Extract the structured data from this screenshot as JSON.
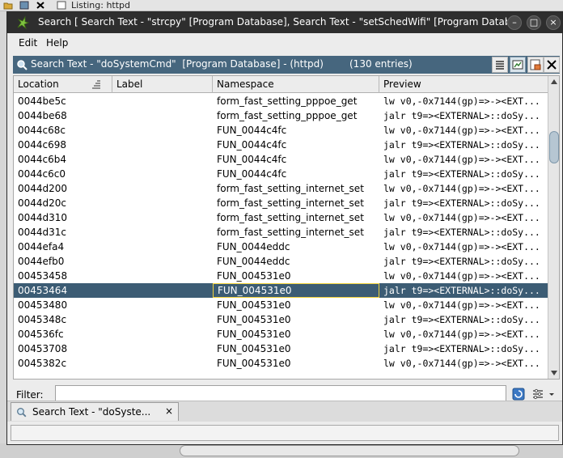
{
  "background": {
    "listing_label": "Listing:  httpd"
  },
  "window": {
    "title": "Search [ Search Text - \"strcpy\"  [Program Database], Search Text - \"setSchedWifi\"  [Program Database],",
    "buttons": {
      "minimize": "–",
      "maximize": "□",
      "close": "×"
    }
  },
  "menu": {
    "edit": "Edit",
    "help": "Help"
  },
  "panel": {
    "title": "Search Text - \"doSystemCmd\"  [Program Database] - (httpd)",
    "count": "(130 entries)"
  },
  "table": {
    "columns": {
      "location": "Location",
      "label": "Label",
      "namespace": "Namespace",
      "preview": "Preview"
    },
    "selected_index": 13,
    "rows": [
      {
        "location": "0044be5c",
        "label": "",
        "namespace": "form_fast_setting_pppoe_get",
        "preview": "lw v0,-0x7144(gp)=>-><EXT..."
      },
      {
        "location": "0044be68",
        "label": "",
        "namespace": "form_fast_setting_pppoe_get",
        "preview": "jalr t9=><EXTERNAL>::doSy..."
      },
      {
        "location": "0044c68c",
        "label": "",
        "namespace": "FUN_0044c4fc",
        "preview": "lw v0,-0x7144(gp)=>-><EXT..."
      },
      {
        "location": "0044c698",
        "label": "",
        "namespace": "FUN_0044c4fc",
        "preview": "jalr t9=><EXTERNAL>::doSy..."
      },
      {
        "location": "0044c6b4",
        "label": "",
        "namespace": "FUN_0044c4fc",
        "preview": "lw v0,-0x7144(gp)=>-><EXT..."
      },
      {
        "location": "0044c6c0",
        "label": "",
        "namespace": "FUN_0044c4fc",
        "preview": "jalr t9=><EXTERNAL>::doSy..."
      },
      {
        "location": "0044d200",
        "label": "",
        "namespace": "form_fast_setting_internet_set",
        "preview": "lw v0,-0x7144(gp)=>-><EXT..."
      },
      {
        "location": "0044d20c",
        "label": "",
        "namespace": "form_fast_setting_internet_set",
        "preview": "jalr t9=><EXTERNAL>::doSy..."
      },
      {
        "location": "0044d310",
        "label": "",
        "namespace": "form_fast_setting_internet_set",
        "preview": "lw v0,-0x7144(gp)=>-><EXT..."
      },
      {
        "location": "0044d31c",
        "label": "",
        "namespace": "form_fast_setting_internet_set",
        "preview": "jalr t9=><EXTERNAL>::doSy..."
      },
      {
        "location": "0044efa4",
        "label": "",
        "namespace": "FUN_0044eddc",
        "preview": "lw v0,-0x7144(gp)=>-><EXT..."
      },
      {
        "location": "0044efb0",
        "label": "",
        "namespace": "FUN_0044eddc",
        "preview": "jalr t9=><EXTERNAL>::doSy..."
      },
      {
        "location": "00453458",
        "label": "",
        "namespace": "FUN_004531e0",
        "preview": "lw v0,-0x7144(gp)=>-><EXT..."
      },
      {
        "location": "00453464",
        "label": "",
        "namespace": "FUN_004531e0",
        "preview": "jalr t9=><EXTERNAL>::doSy..."
      },
      {
        "location": "00453480",
        "label": "",
        "namespace": "FUN_004531e0",
        "preview": "lw v0,-0x7144(gp)=>-><EXT..."
      },
      {
        "location": "0045348c",
        "label": "",
        "namespace": "FUN_004531e0",
        "preview": "jalr t9=><EXTERNAL>::doSy..."
      },
      {
        "location": "004536fc",
        "label": "",
        "namespace": "FUN_004531e0",
        "preview": "lw v0,-0x7144(gp)=>-><EXT..."
      },
      {
        "location": "00453708",
        "label": "",
        "namespace": "FUN_004531e0",
        "preview": "jalr t9=><EXTERNAL>::doSy..."
      },
      {
        "location": "0045382c",
        "label": "",
        "namespace": "FUN_004531e0",
        "preview": "lw v0,-0x7144(gp)=>-><EXT..."
      }
    ]
  },
  "filter": {
    "label": "Filter:",
    "value": "",
    "placeholder": ""
  },
  "tabs": [
    {
      "label": "Search Text - \"doSyste...",
      "close": "×"
    }
  ],
  "icons": {
    "app": "ghidra-dragon-icon",
    "panel": "search-icon",
    "column_sort": "sort-icon",
    "snapshot": "snapshot-icon",
    "make_selection": "select-icon",
    "close": "close-icon",
    "filter_options": "filter-options-icon",
    "filter_menu": "chevron-down-icon"
  },
  "colors": {
    "titlebar": "#2e2e2e",
    "panel_header": "#46667e",
    "selected_row": "#3c5c74",
    "selected_cell_border": "#f0d23c"
  }
}
